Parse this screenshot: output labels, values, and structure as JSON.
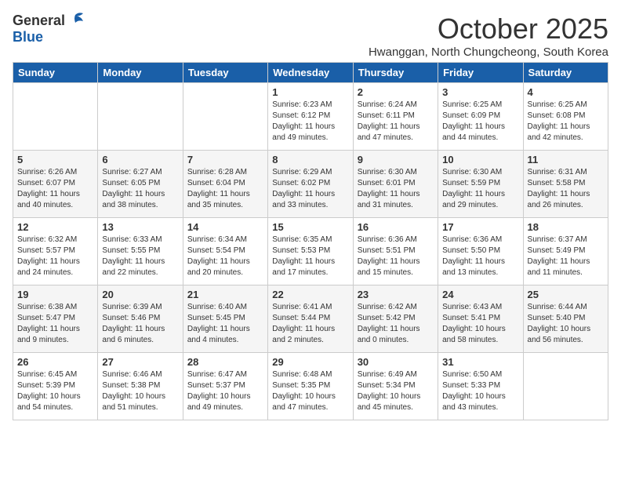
{
  "logo": {
    "general": "General",
    "blue": "Blue"
  },
  "title": "October 2025",
  "subtitle": "Hwanggan, North Chungcheong, South Korea",
  "weekdays": [
    "Sunday",
    "Monday",
    "Tuesday",
    "Wednesday",
    "Thursday",
    "Friday",
    "Saturday"
  ],
  "weeks": [
    [
      {
        "day": "",
        "info": ""
      },
      {
        "day": "",
        "info": ""
      },
      {
        "day": "",
        "info": ""
      },
      {
        "day": "1",
        "info": "Sunrise: 6:23 AM\nSunset: 6:12 PM\nDaylight: 11 hours\nand 49 minutes."
      },
      {
        "day": "2",
        "info": "Sunrise: 6:24 AM\nSunset: 6:11 PM\nDaylight: 11 hours\nand 47 minutes."
      },
      {
        "day": "3",
        "info": "Sunrise: 6:25 AM\nSunset: 6:09 PM\nDaylight: 11 hours\nand 44 minutes."
      },
      {
        "day": "4",
        "info": "Sunrise: 6:25 AM\nSunset: 6:08 PM\nDaylight: 11 hours\nand 42 minutes."
      }
    ],
    [
      {
        "day": "5",
        "info": "Sunrise: 6:26 AM\nSunset: 6:07 PM\nDaylight: 11 hours\nand 40 minutes."
      },
      {
        "day": "6",
        "info": "Sunrise: 6:27 AM\nSunset: 6:05 PM\nDaylight: 11 hours\nand 38 minutes."
      },
      {
        "day": "7",
        "info": "Sunrise: 6:28 AM\nSunset: 6:04 PM\nDaylight: 11 hours\nand 35 minutes."
      },
      {
        "day": "8",
        "info": "Sunrise: 6:29 AM\nSunset: 6:02 PM\nDaylight: 11 hours\nand 33 minutes."
      },
      {
        "day": "9",
        "info": "Sunrise: 6:30 AM\nSunset: 6:01 PM\nDaylight: 11 hours\nand 31 minutes."
      },
      {
        "day": "10",
        "info": "Sunrise: 6:30 AM\nSunset: 5:59 PM\nDaylight: 11 hours\nand 29 minutes."
      },
      {
        "day": "11",
        "info": "Sunrise: 6:31 AM\nSunset: 5:58 PM\nDaylight: 11 hours\nand 26 minutes."
      }
    ],
    [
      {
        "day": "12",
        "info": "Sunrise: 6:32 AM\nSunset: 5:57 PM\nDaylight: 11 hours\nand 24 minutes."
      },
      {
        "day": "13",
        "info": "Sunrise: 6:33 AM\nSunset: 5:55 PM\nDaylight: 11 hours\nand 22 minutes."
      },
      {
        "day": "14",
        "info": "Sunrise: 6:34 AM\nSunset: 5:54 PM\nDaylight: 11 hours\nand 20 minutes."
      },
      {
        "day": "15",
        "info": "Sunrise: 6:35 AM\nSunset: 5:53 PM\nDaylight: 11 hours\nand 17 minutes."
      },
      {
        "day": "16",
        "info": "Sunrise: 6:36 AM\nSunset: 5:51 PM\nDaylight: 11 hours\nand 15 minutes."
      },
      {
        "day": "17",
        "info": "Sunrise: 6:36 AM\nSunset: 5:50 PM\nDaylight: 11 hours\nand 13 minutes."
      },
      {
        "day": "18",
        "info": "Sunrise: 6:37 AM\nSunset: 5:49 PM\nDaylight: 11 hours\nand 11 minutes."
      }
    ],
    [
      {
        "day": "19",
        "info": "Sunrise: 6:38 AM\nSunset: 5:47 PM\nDaylight: 11 hours\nand 9 minutes."
      },
      {
        "day": "20",
        "info": "Sunrise: 6:39 AM\nSunset: 5:46 PM\nDaylight: 11 hours\nand 6 minutes."
      },
      {
        "day": "21",
        "info": "Sunrise: 6:40 AM\nSunset: 5:45 PM\nDaylight: 11 hours\nand 4 minutes."
      },
      {
        "day": "22",
        "info": "Sunrise: 6:41 AM\nSunset: 5:44 PM\nDaylight: 11 hours\nand 2 minutes."
      },
      {
        "day": "23",
        "info": "Sunrise: 6:42 AM\nSunset: 5:42 PM\nDaylight: 11 hours\nand 0 minutes."
      },
      {
        "day": "24",
        "info": "Sunrise: 6:43 AM\nSunset: 5:41 PM\nDaylight: 10 hours\nand 58 minutes."
      },
      {
        "day": "25",
        "info": "Sunrise: 6:44 AM\nSunset: 5:40 PM\nDaylight: 10 hours\nand 56 minutes."
      }
    ],
    [
      {
        "day": "26",
        "info": "Sunrise: 6:45 AM\nSunset: 5:39 PM\nDaylight: 10 hours\nand 54 minutes."
      },
      {
        "day": "27",
        "info": "Sunrise: 6:46 AM\nSunset: 5:38 PM\nDaylight: 10 hours\nand 51 minutes."
      },
      {
        "day": "28",
        "info": "Sunrise: 6:47 AM\nSunset: 5:37 PM\nDaylight: 10 hours\nand 49 minutes."
      },
      {
        "day": "29",
        "info": "Sunrise: 6:48 AM\nSunset: 5:35 PM\nDaylight: 10 hours\nand 47 minutes."
      },
      {
        "day": "30",
        "info": "Sunrise: 6:49 AM\nSunset: 5:34 PM\nDaylight: 10 hours\nand 45 minutes."
      },
      {
        "day": "31",
        "info": "Sunrise: 6:50 AM\nSunset: 5:33 PM\nDaylight: 10 hours\nand 43 minutes."
      },
      {
        "day": "",
        "info": ""
      }
    ]
  ]
}
